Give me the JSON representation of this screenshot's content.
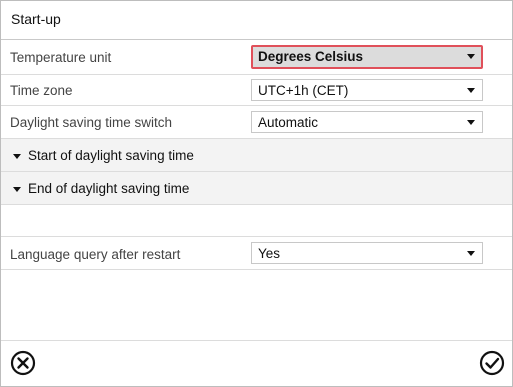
{
  "window": {
    "title": "Start-up"
  },
  "settings": {
    "temperature_unit": {
      "label": "Temperature unit",
      "value": "Degrees Celsius"
    },
    "time_zone": {
      "label": "Time zone",
      "value": "UTC+1h (CET)"
    },
    "dst_switch": {
      "label": "Daylight saving time switch",
      "value": "Automatic"
    },
    "start_dst": {
      "label": "Start of daylight saving time"
    },
    "end_dst": {
      "label": "End of daylight saving time"
    },
    "language_query": {
      "label": "Language query after restart",
      "value": "Yes"
    }
  },
  "footer": {
    "cancel_icon": "circle-x-icon",
    "confirm_icon": "circle-check-icon"
  },
  "colors": {
    "focus_border": "#e0505a",
    "focus_fill": "#dcdcdc"
  }
}
